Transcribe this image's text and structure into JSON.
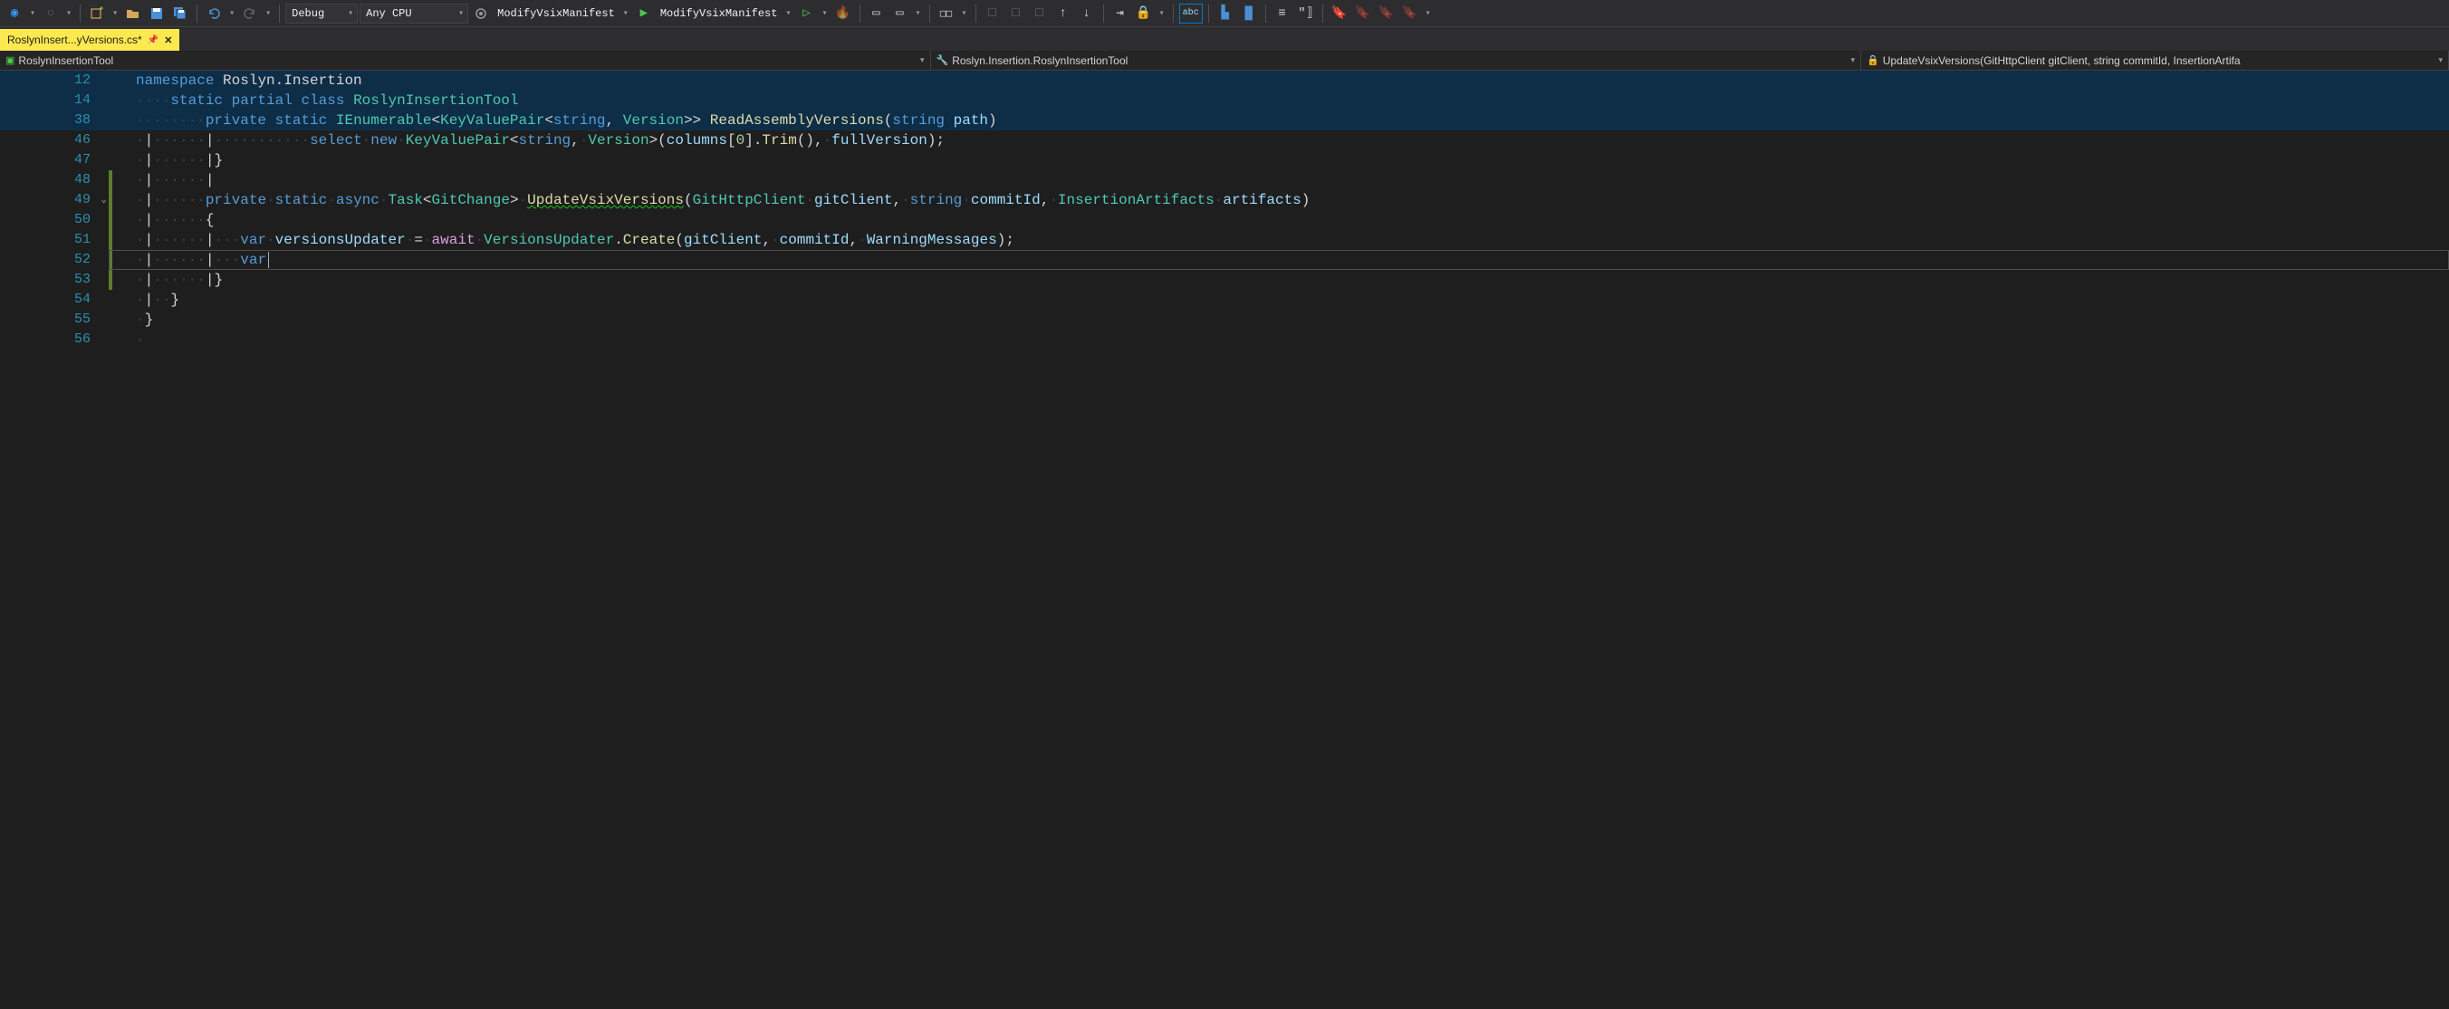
{
  "toolbar": {
    "config": "Debug",
    "platform": "Any CPU",
    "target1": "ModifyVsixManifest",
    "target2": "ModifyVsixManifest"
  },
  "tab": {
    "title": "RoslynInsert...yVersions.cs*"
  },
  "nav": {
    "project": "RoslynInsertionTool",
    "type": "Roslyn.Insertion.RoslynInsertionTool",
    "member": "UpdateVsixVersions(GitHttpClient gitClient, string commitId, InsertionArtifa"
  },
  "lines": [
    {
      "num": "12",
      "sticky": true
    },
    {
      "num": "14",
      "sticky": true
    },
    {
      "num": "38",
      "sticky": true
    },
    {
      "num": "46"
    },
    {
      "num": "47"
    },
    {
      "num": "48"
    },
    {
      "num": "49"
    },
    {
      "num": "50"
    },
    {
      "num": "51"
    },
    {
      "num": "52"
    },
    {
      "num": "53"
    },
    {
      "num": "54"
    },
    {
      "num": "55"
    },
    {
      "num": "56"
    }
  ],
  "code": {
    "l12": {
      "kw1": "namespace",
      "ns": "Roslyn.Insertion"
    },
    "l14": {
      "kw1": "static",
      "kw2": "partial",
      "kw3": "class",
      "cls": "RoslynInsertionTool"
    },
    "l38": {
      "kw1": "private",
      "kw2": "static",
      "ret": "IEnumerable",
      "gp1": "KeyValuePair",
      "gp2": "string",
      "gp3": "Version",
      "name": "ReadAssemblyVersions",
      "pt": "string",
      "pn": "path"
    },
    "l46": {
      "kw": "select",
      "kw2": "new",
      "t": "KeyValuePair",
      "g1": "string",
      "g2": "Version",
      "c": "columns",
      "n": "0",
      "m": "Trim",
      "v": "fullVersion"
    },
    "l47": {
      "brace": "}"
    },
    "l49": {
      "kw1": "private",
      "kw2": "static",
      "kw3": "async",
      "ret": "Task",
      "gen": "GitChange",
      "name": "UpdateVsixVersions",
      "pt1": "GitHttpClient",
      "pn1": "gitClient",
      "pt2": "string",
      "pn2": "commitId",
      "pt3": "InsertionArtifacts",
      "pn3": "artifacts"
    },
    "l50": {
      "brace": "{"
    },
    "l51": {
      "kw1": "var",
      "v1": "versionsUpdater",
      "kw2": "await",
      "t": "VersionsUpdater",
      "m": "Create",
      "a1": "gitClient",
      "a2": "commitId",
      "a3": "WarningMessages"
    },
    "l52": {
      "kw": "var"
    },
    "l53": {
      "brace": "}"
    },
    "l54": {
      "brace": "}"
    },
    "l55": {
      "brace": "}"
    }
  }
}
